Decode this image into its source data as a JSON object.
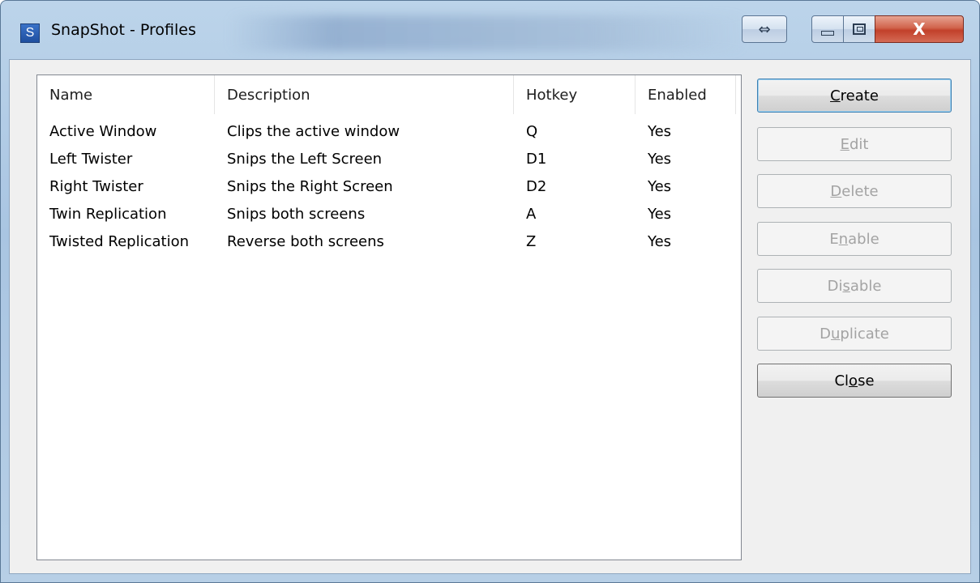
{
  "window": {
    "title": "SnapShot - Profiles",
    "app_icon_letter": "S",
    "resize_glyph": "⇔",
    "close_glyph": "X"
  },
  "listview": {
    "columns": [
      "Name",
      "Description",
      "Hotkey",
      "Enabled"
    ],
    "rows": [
      {
        "name": "Active Window",
        "description": "Clips the active window",
        "hotkey": "Q",
        "enabled": "Yes"
      },
      {
        "name": "Left Twister",
        "description": "Snips the Left Screen",
        "hotkey": "D1",
        "enabled": "Yes"
      },
      {
        "name": "Right Twister",
        "description": "Snips the Right Screen",
        "hotkey": "D2",
        "enabled": "Yes"
      },
      {
        "name": "Twin Replication",
        "description": "Snips both screens",
        "hotkey": "A",
        "enabled": "Yes"
      },
      {
        "name": "Twisted Replication",
        "description": "Reverse both screens",
        "hotkey": "Z",
        "enabled": "Yes"
      }
    ]
  },
  "buttons": [
    {
      "id": "create",
      "label": "Create",
      "accel_index": 0,
      "enabled": true
    },
    {
      "id": "edit",
      "label": "Edit",
      "accel_index": 0,
      "enabled": false
    },
    {
      "id": "delete",
      "label": "Delete",
      "accel_index": 0,
      "enabled": false
    },
    {
      "id": "enable",
      "label": "Enable",
      "accel_index": 1,
      "enabled": false
    },
    {
      "id": "disable",
      "label": "Disable",
      "accel_index": 2,
      "enabled": false
    },
    {
      "id": "duplicate",
      "label": "Duplicate",
      "accel_index": 1,
      "enabled": false
    },
    {
      "id": "close",
      "label": "Close",
      "accel_index": 2,
      "enabled": true
    }
  ]
}
